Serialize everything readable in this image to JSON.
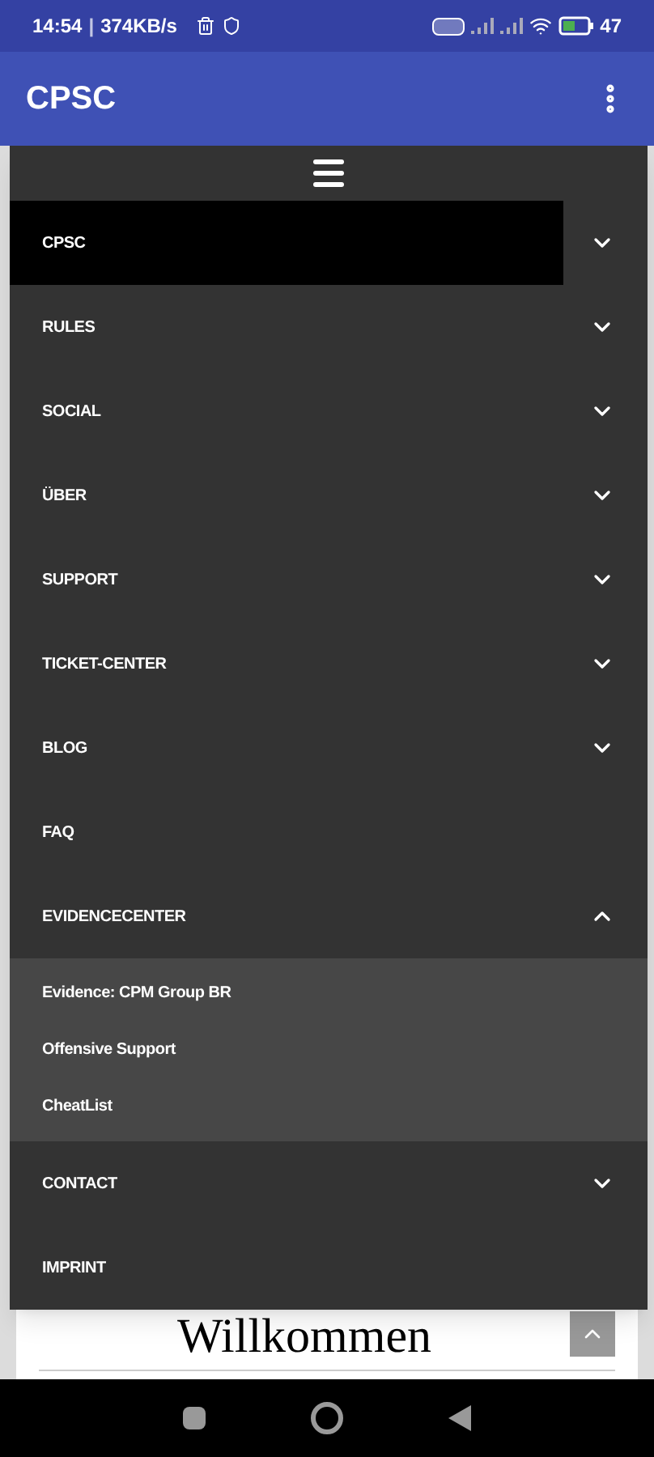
{
  "status_bar": {
    "time": "14:54",
    "separator": "|",
    "speed": "374KB/s",
    "battery": "47"
  },
  "app_bar": {
    "title": "CPSC"
  },
  "menu": {
    "items": [
      {
        "label": "CPSC",
        "kind": "dropdown",
        "selected": true,
        "expanded": false
      },
      {
        "label": "RULES",
        "kind": "dropdown",
        "selected": false,
        "expanded": false
      },
      {
        "label": "SOCIAL",
        "kind": "dropdown",
        "selected": false,
        "expanded": false
      },
      {
        "label": "ÜBER",
        "kind": "dropdown",
        "selected": false,
        "expanded": false
      },
      {
        "label": "SUPPORT",
        "kind": "dropdown",
        "selected": false,
        "expanded": false
      },
      {
        "label": "TICKET-CENTER",
        "kind": "dropdown",
        "selected": false,
        "expanded": false
      },
      {
        "label": "BLOG",
        "kind": "dropdown",
        "selected": false,
        "expanded": false
      },
      {
        "label": "FAQ",
        "kind": "link",
        "selected": false
      },
      {
        "label": "EVIDENCECENTER",
        "kind": "dropdown",
        "selected": false,
        "expanded": true,
        "children": [
          {
            "label": "Evidence: CPM Group BR"
          },
          {
            "label": "Offensive Support"
          },
          {
            "label": "CheatList"
          }
        ]
      },
      {
        "label": "CONTACT",
        "kind": "dropdown",
        "selected": false,
        "expanded": false
      },
      {
        "label": "IMPRINT",
        "kind": "link",
        "selected": false
      }
    ]
  },
  "page": {
    "heading": "Willkommen"
  }
}
